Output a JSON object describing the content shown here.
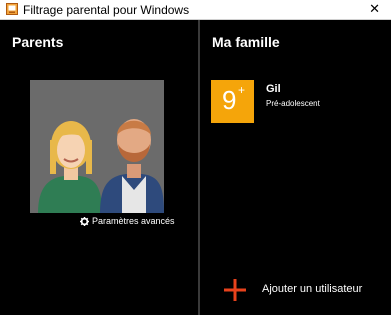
{
  "window": {
    "title": "Filtrage parental pour Windows",
    "close_glyph": "✕",
    "app_icon": "app-icon"
  },
  "parents": {
    "heading": "Parents",
    "settings_label": "Paramètres avancés",
    "settings_icon": "gear-icon"
  },
  "family": {
    "heading": "Ma famille",
    "members": [
      {
        "age_badge": "9",
        "age_suffix": "+",
        "name": "Gil",
        "role": "Pré-adolescent"
      }
    ],
    "add_user_label": "Ajouter un utilisateur",
    "add_user_icon": "plus-icon"
  },
  "colors": {
    "accent_orange": "#f5a50a",
    "add_plus": "#e8421c",
    "background": "#000000",
    "text": "#ffffff"
  }
}
